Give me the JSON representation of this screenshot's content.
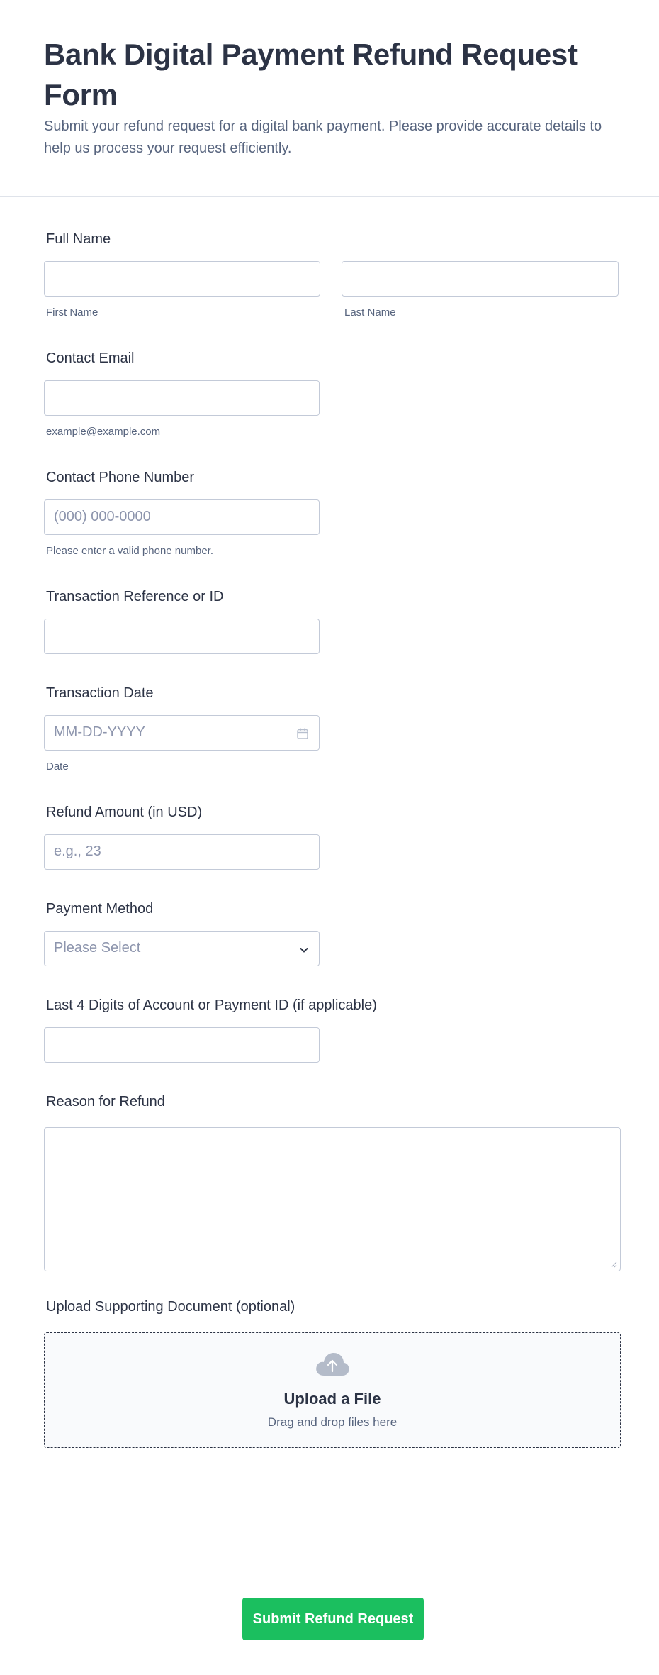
{
  "form": {
    "title": "Bank Digital Payment Refund Request Form",
    "description": "Submit your refund request for a digital bank payment. Please provide accurate details to help us process your request efficiently."
  },
  "full_name": {
    "label": "Full Name",
    "first_sublabel": "First Name",
    "last_sublabel": "Last Name",
    "first_value": "",
    "last_value": ""
  },
  "email": {
    "label": "Contact Email",
    "sublabel": "example@example.com",
    "value": ""
  },
  "phone": {
    "label": "Contact Phone Number",
    "placeholder": "(000) 000-0000",
    "sublabel": "Please enter a valid phone number."
  },
  "transaction_ref": {
    "label": "Transaction Reference or ID",
    "value": ""
  },
  "transaction_date": {
    "label": "Transaction Date",
    "placeholder": "MM-DD-YYYY",
    "sublabel": "Date",
    "icon": "calendar-icon"
  },
  "refund_amount": {
    "label": "Refund Amount (in USD)",
    "placeholder": "e.g., 23"
  },
  "payment_method": {
    "label": "Payment Method",
    "selected": "Please Select",
    "icon": "chevron-down-icon"
  },
  "last4": {
    "label": "Last 4 Digits of Account or Payment ID (if applicable)",
    "value": ""
  },
  "reason": {
    "label": "Reason for Refund",
    "value": ""
  },
  "upload": {
    "label": "Upload Supporting Document (optional)",
    "title": "Upload a File",
    "subtitle": "Drag and drop files here",
    "icon": "cloud-upload-icon"
  },
  "submit": {
    "label": "Submit Refund Request",
    "color": "#1bbf5f"
  },
  "colors": {
    "text": "#2c3345",
    "muted": "#57647e",
    "border": "#c3cad8",
    "placeholder": "#8d95ad"
  }
}
